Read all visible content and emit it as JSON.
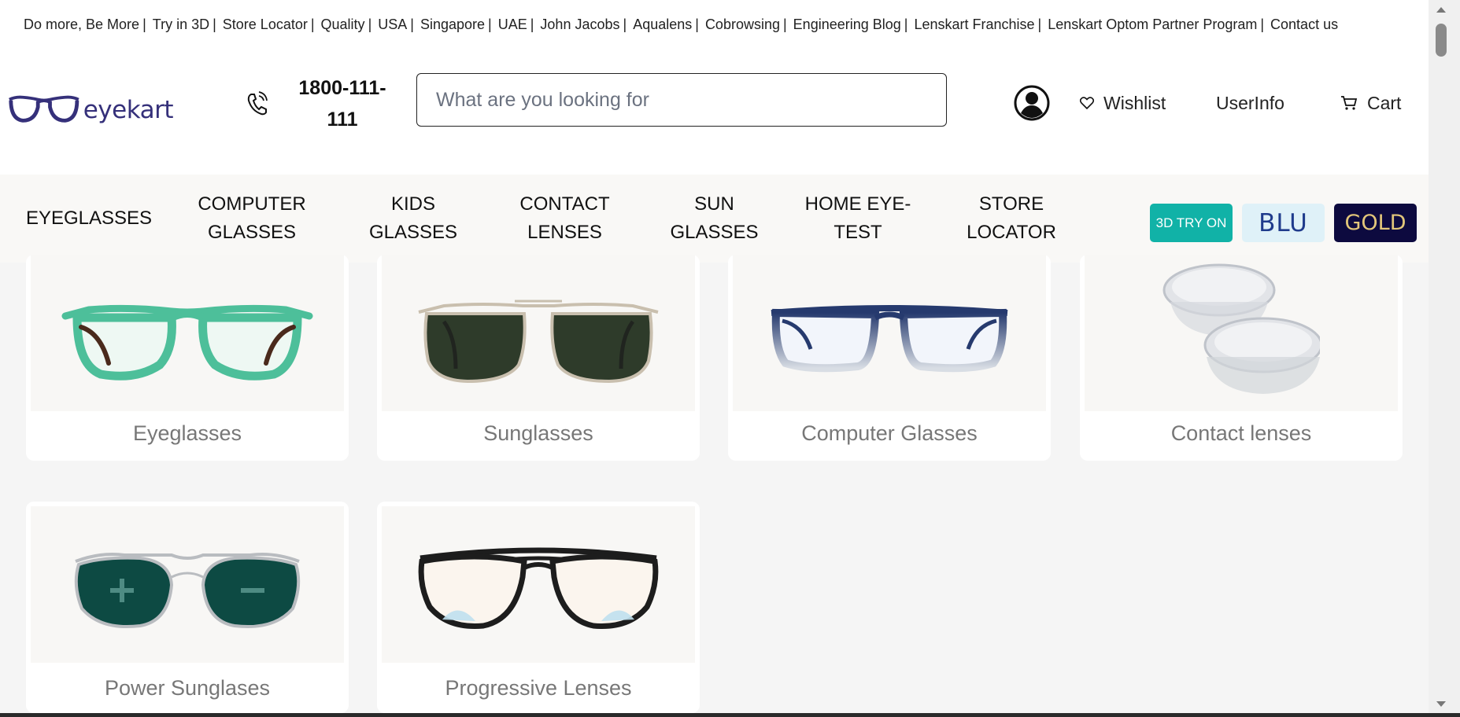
{
  "topbar": {
    "links": [
      "Do more, Be More",
      "Try in 3D",
      "Store Locator",
      "Quality",
      "USA",
      "Singapore",
      "UAE",
      "John Jacobs",
      "Aqualens",
      "Cobrowsing",
      "Engineering Blog",
      "Lenskart Franchise",
      "Lenskart Optom Partner Program",
      "Contact us"
    ],
    "separator": "|"
  },
  "header": {
    "logo_text": "eyekart",
    "phone": "1800-111-111",
    "search_placeholder": "What are you looking for",
    "wishlist_label": "Wishlist",
    "userinfo_label": "UserInfo",
    "cart_label": "Cart"
  },
  "nav": {
    "items": [
      "EYEGLASSES",
      "COMPUTER GLASSES",
      "KIDS GLASSES",
      "CONTACT LENSES",
      "SUN GLASSES",
      "HOME EYE-TEST",
      "STORE LOCATOR"
    ],
    "badge_3d": "3D TRY ON",
    "badge_blu": "BLU",
    "badge_gold": "GOLD"
  },
  "categories": [
    "Eyeglasses",
    "Sunglasses",
    "Computer Glasses",
    "Contact lenses",
    "Power Sunglases",
    "Progressive Lenses"
  ],
  "colors": {
    "brand": "#35307a",
    "teal_badge": "#11b2a7",
    "blu_bg": "#dff1f8",
    "gold_bg": "#0d0a3f",
    "gold_text": "#e3c77a"
  },
  "icons": [
    "phone-icon",
    "account-icon",
    "heart-icon",
    "cart-icon",
    "glasses-logo-icon"
  ]
}
